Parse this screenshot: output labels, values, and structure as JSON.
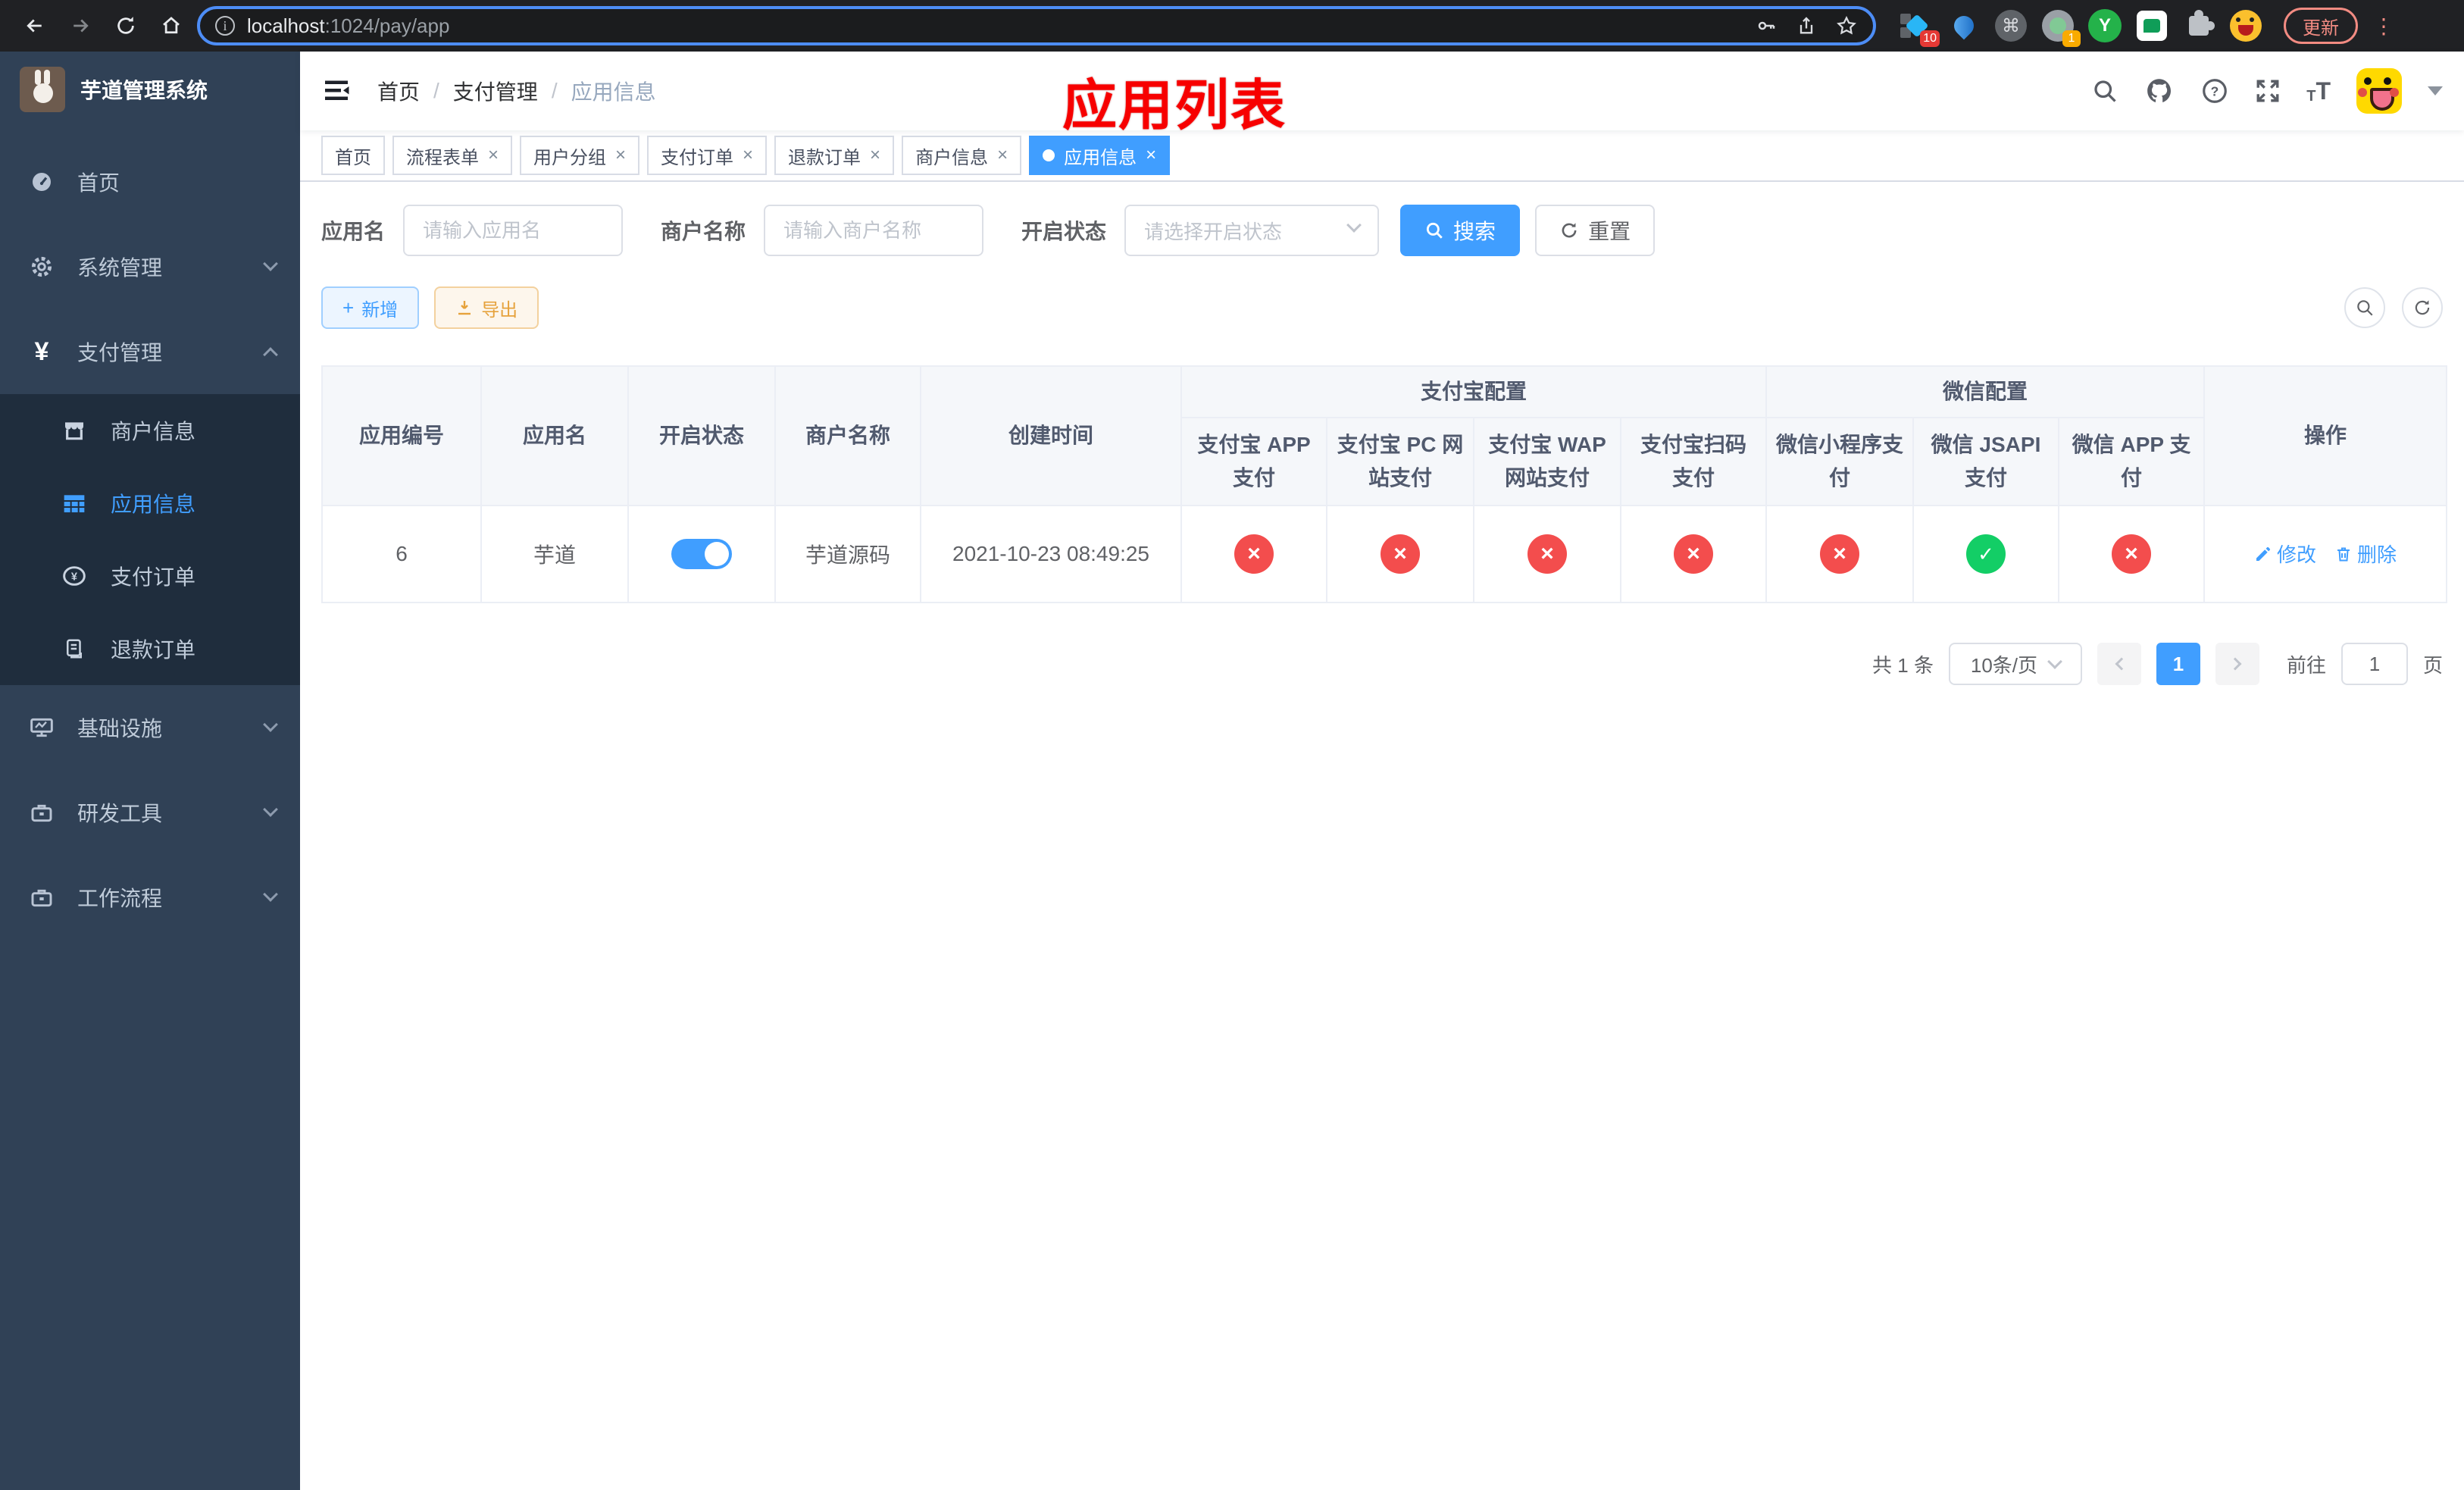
{
  "browser": {
    "url_host": "localhost",
    "url_path": ":1024/pay/app",
    "update_label": "更新",
    "badges": [
      "10",
      "1"
    ],
    "ext_y_label": "Y"
  },
  "sidebar": {
    "logo_title": "芋道管理系统",
    "menu": [
      {
        "label": "首页",
        "icon": "dashboard-icon"
      },
      {
        "label": "系统管理",
        "icon": "gear-icon"
      },
      {
        "label": "支付管理",
        "icon": "yen-icon"
      },
      {
        "label": "基础设施",
        "icon": "monitor-icon"
      },
      {
        "label": "研发工具",
        "icon": "toolbox-icon"
      },
      {
        "label": "工作流程",
        "icon": "briefcase-icon"
      }
    ],
    "submenu_pay": [
      {
        "label": "商户信息",
        "icon": "store-icon"
      },
      {
        "label": "应用信息",
        "icon": "grid-icon",
        "active": true
      },
      {
        "label": "支付订单",
        "icon": "coin-icon"
      },
      {
        "label": "退款订单",
        "icon": "document-icon"
      }
    ]
  },
  "header": {
    "breadcrumb": [
      "首页",
      "支付管理",
      "应用信息"
    ],
    "breadcrumb_sep": "/"
  },
  "annotation": {
    "title": "应用列表"
  },
  "tabs": [
    {
      "label": "首页",
      "closable": false
    },
    {
      "label": "流程表单",
      "closable": true
    },
    {
      "label": "用户分组",
      "closable": true
    },
    {
      "label": "支付订单",
      "closable": true
    },
    {
      "label": "退款订单",
      "closable": true
    },
    {
      "label": "商户信息",
      "closable": true
    },
    {
      "label": "应用信息",
      "closable": true,
      "active": true
    }
  ],
  "tab_close_glyph": "×",
  "filters": {
    "app_name_label": "应用名",
    "app_name_placeholder": "请输入应用名",
    "merchant_label": "商户名称",
    "merchant_placeholder": "请输入商户名称",
    "status_label": "开启状态",
    "status_placeholder": "请选择开启状态",
    "search_label": "搜索",
    "reset_label": "重置"
  },
  "toolbar": {
    "add_label": "新增",
    "export_label": "导出"
  },
  "table": {
    "columns": {
      "id": "应用编号",
      "name": "应用名",
      "status": "开启状态",
      "merchant": "商户名称",
      "created": "创建时间",
      "alipay_group": "支付宝配置",
      "wechat_group": "微信配置",
      "actions": "操作",
      "pay_cols": [
        "支付宝 APP 支付",
        "支付宝 PC 网站支付",
        "支付宝 WAP 网站支付",
        "支付宝扫码支付",
        "微信小程序支付",
        "微信 JSAPI 支付",
        "微信 APP 支付"
      ]
    },
    "rows": [
      {
        "id": "6",
        "name": "芋道",
        "enabled": true,
        "merchant": "芋道源码",
        "created": "2021-10-23 08:49:25",
        "pay_status": [
          "cross",
          "cross",
          "cross",
          "cross",
          "cross",
          "check",
          "cross"
        ],
        "edit_label": "修改",
        "delete_label": "删除"
      }
    ]
  },
  "pagination": {
    "total_text": "共 1 条",
    "page_size": "10条/页",
    "current_page": "1",
    "goto_label": "前往",
    "goto_value": "1",
    "page_suffix": "页"
  },
  "colors": {
    "primary": "#409EFF",
    "success": "#13ce66",
    "danger": "#f34d4d",
    "warning": "#e6a23c",
    "sidebar_bg": "#304156",
    "submenu_bg": "#1f2d3d",
    "annotation_red": "#f70000"
  }
}
